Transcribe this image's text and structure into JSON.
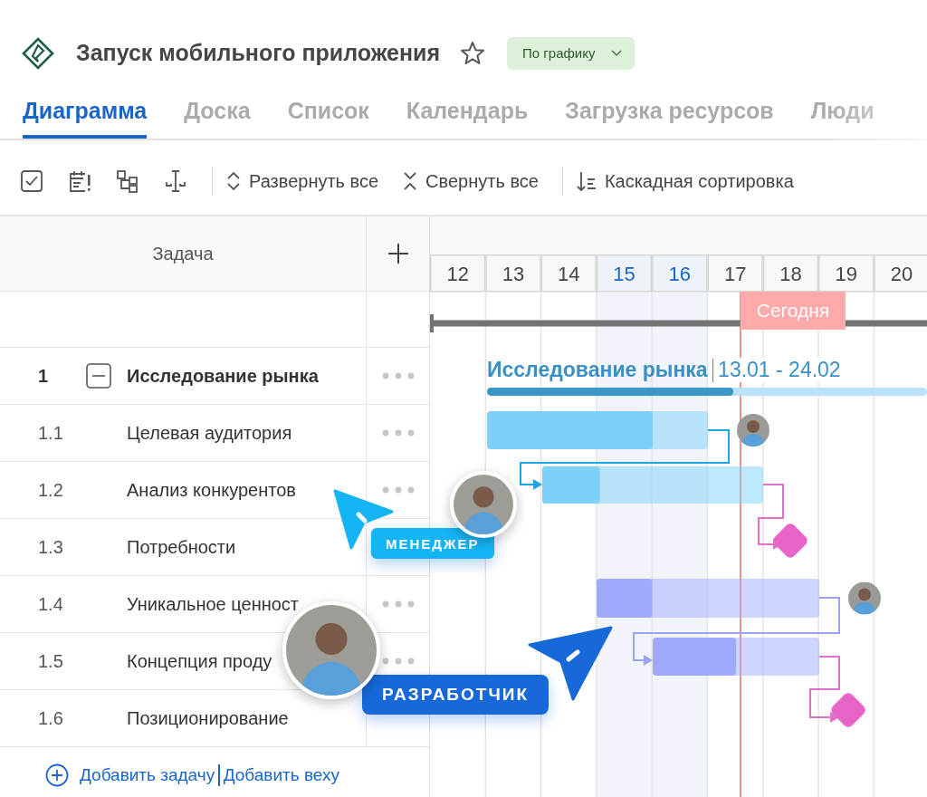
{
  "project": {
    "title": "Запуск мобильного приложения",
    "starred": false,
    "status": "По графику"
  },
  "tabs": [
    {
      "label": "Диаграмма",
      "selected": true
    },
    {
      "label": "Доска",
      "selected": false
    },
    {
      "label": "Список",
      "selected": false
    },
    {
      "label": "Календарь",
      "selected": false
    },
    {
      "label": "Загрузка ресурсов",
      "selected": false
    },
    {
      "label": "Люди",
      "selected": false
    }
  ],
  "toolbar": {
    "actions": [
      {
        "kind": "expand",
        "label": "Развернуть все"
      },
      {
        "kind": "collapse",
        "label": "Свернуть все"
      },
      {
        "kind": "sort",
        "label": "Каскадная сортировка"
      }
    ]
  },
  "task_table": {
    "column": "Задача",
    "tasks": [
      {
        "number": "1",
        "name": "Исследование рынка",
        "expanded": true,
        "more_button": true,
        "children": [
          {
            "number": "1.1",
            "name": "Целевая аудитория",
            "more_button": true
          },
          {
            "number": "1.2",
            "name": "Анализ конкурентов",
            "more_button": true
          },
          {
            "number": "1.3",
            "name": "Потребности",
            "more_button": false
          },
          {
            "number": "1.4",
            "name": "Уникальное ценност",
            "more_button": true
          },
          {
            "number": "1.5",
            "name": "Концепция проду",
            "more_button": true
          },
          {
            "number": "1.6",
            "name": "Позиционирование",
            "more_button": false
          }
        ]
      }
    ],
    "add_task": "Добавить задачу",
    "add_milestone": "Добавить веху"
  },
  "timeline": {
    "days": [
      {
        "label": "12",
        "weekend": false
      },
      {
        "label": "13",
        "weekend": false
      },
      {
        "label": "14",
        "weekend": false
      },
      {
        "label": "15",
        "weekend": true
      },
      {
        "label": "16",
        "weekend": true
      },
      {
        "label": "17",
        "weekend": false
      },
      {
        "label": "18",
        "weekend": false
      },
      {
        "label": "19",
        "weekend": false
      },
      {
        "label": "20",
        "weekend": false
      }
    ],
    "today": "Сегодня",
    "summary": {
      "name": "Исследование рынка",
      "dates": "13.01 - 24.02",
      "level": 0.56
    },
    "bars": [
      {
        "kind": "bar",
        "color": "#7dd1f9",
        "level": 0.75,
        "assignee": true
      },
      {
        "kind": "bar",
        "color": "#7dd1f9",
        "level": 0.26,
        "assignee": false
      },
      {
        "kind": "milestone",
        "color": "#e864c8"
      },
      {
        "kind": "bar",
        "color": "#9eabfd",
        "level": 0.25,
        "assignee": true
      },
      {
        "kind": "bar",
        "color": "#9eabfd",
        "level": 0.5,
        "assignee": false
      },
      {
        "kind": "milestone",
        "color": "#e864c8"
      }
    ]
  },
  "collaborators": [
    {
      "role": "МЕНЕДЖЕР",
      "color": "#14b4f5"
    },
    {
      "role": "РАЗРАБОТЧИК",
      "color": "#1769d9"
    }
  ]
}
